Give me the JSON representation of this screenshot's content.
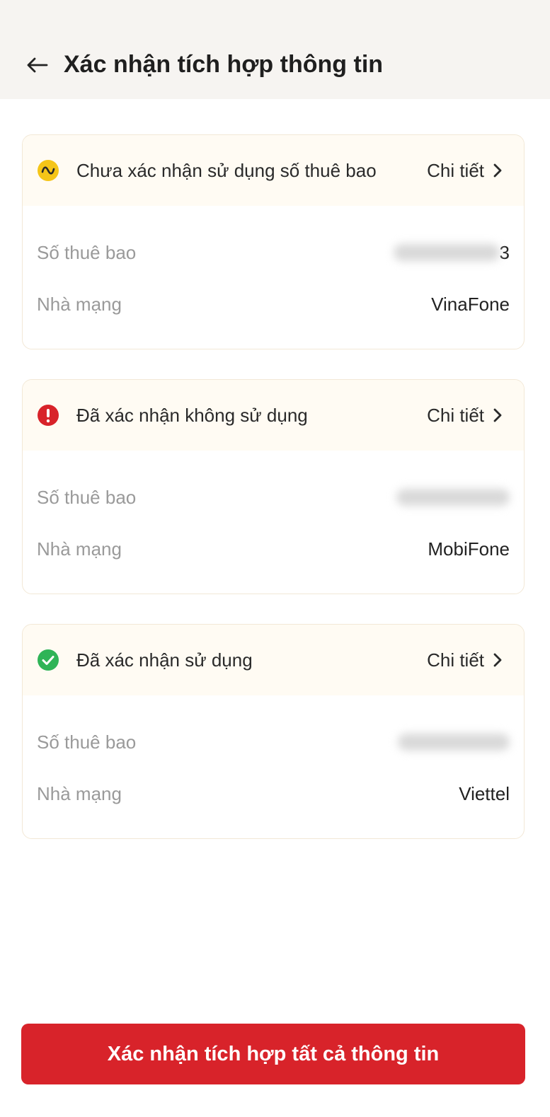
{
  "header": {
    "title": "Xác nhận tích hợp thông tin",
    "back_icon": "arrow-left-icon"
  },
  "colors": {
    "header_bg": "#f6f4f1",
    "card_head_bg": "#fffbf3",
    "pending": "#f5c518",
    "rejected": "#d8232a",
    "confirmed": "#2fb457",
    "primary_button": "#d8232a"
  },
  "cards": [
    {
      "status_icon": "pending-wave-icon",
      "status_text": "Chưa xác nhận sử dụng số thuê bao",
      "detail_label": "Chi tiết",
      "subscriber_label": "Số thuê bao",
      "subscriber_visible_suffix": "3",
      "carrier_label": "Nhà mạng",
      "carrier_value": "VinaFone"
    },
    {
      "status_icon": "exclamation-icon",
      "status_text": "Đã xác nhận không sử dụng",
      "detail_label": "Chi tiết",
      "subscriber_label": "Số thuê bao",
      "subscriber_visible_suffix": "",
      "carrier_label": "Nhà mạng",
      "carrier_value": "MobiFone"
    },
    {
      "status_icon": "check-circle-icon",
      "status_text": "Đã xác nhận sử dụng",
      "detail_label": "Chi tiết",
      "subscriber_label": "Số thuê bao",
      "subscriber_visible_suffix": "",
      "carrier_label": "Nhà mạng",
      "carrier_value": "Viettel"
    }
  ],
  "footer": {
    "confirm_all_label": "Xác nhận tích hợp tất cả thông tin"
  }
}
